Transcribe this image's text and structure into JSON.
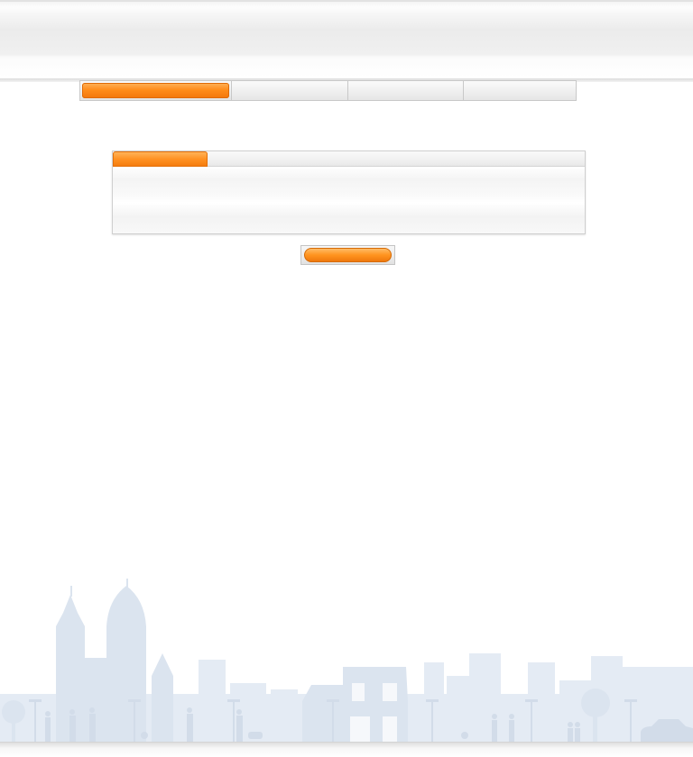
{
  "steps": [
    {
      "label": "",
      "active": true
    },
    {
      "label": "",
      "active": false
    },
    {
      "label": "",
      "active": false
    },
    {
      "label": "",
      "active": false
    }
  ],
  "panel": {
    "active_tab_label": ""
  },
  "action": {
    "label": ""
  },
  "colors": {
    "accent": "#ff8d1c",
    "skyline": "#e3eaf3",
    "skyline_dark": "#d8e1ec"
  }
}
